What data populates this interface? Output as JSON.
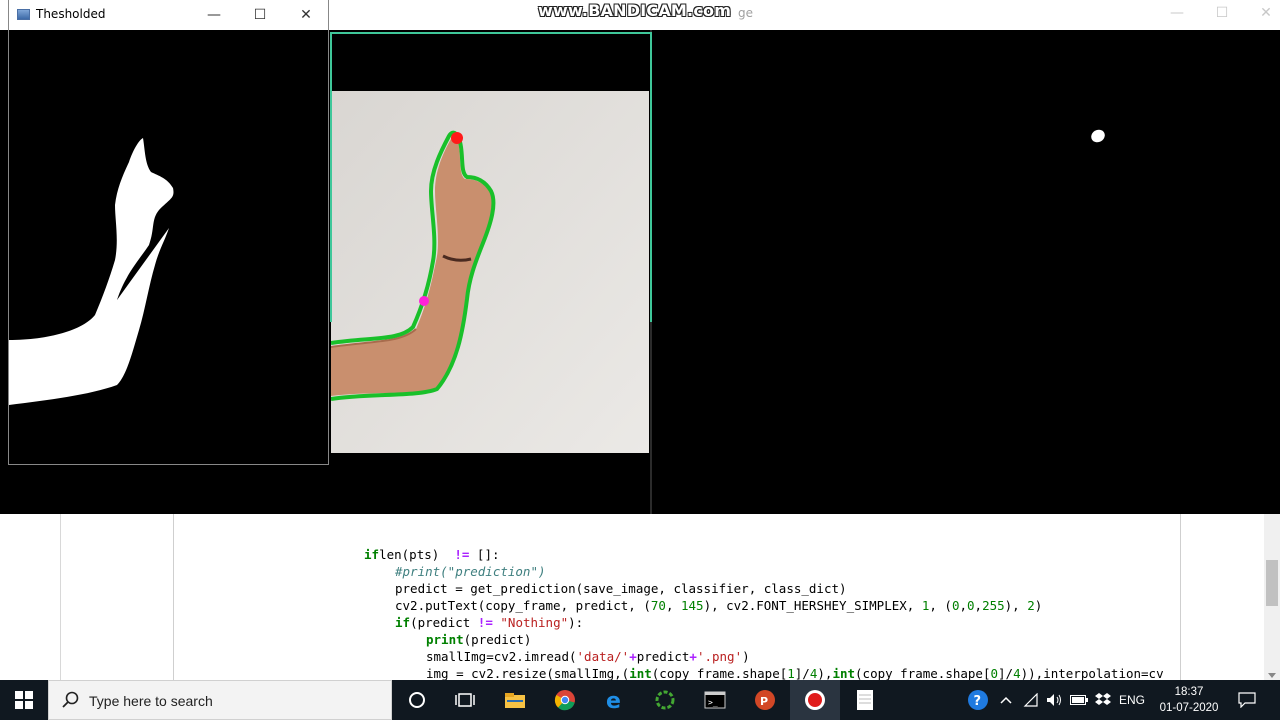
{
  "watermark": "www.BANDICAM.com",
  "camera_window": {
    "title_fragment": "ge"
  },
  "threshold_window": {
    "title": "Thesholded",
    "minimize": "—",
    "maximize": "☐",
    "close": "✕"
  },
  "code_lines": [
    {
      "indent": 0,
      "parts": [
        [
          "kw",
          "if"
        ],
        [
          "",
          "len(pts)  "
        ],
        [
          "op",
          "!="
        ],
        [
          "",
          " []:"
        ]
      ]
    },
    {
      "indent": 1,
      "parts": [
        [
          "cm",
          "#print(\"prediction\")"
        ]
      ]
    },
    {
      "indent": 1,
      "parts": [
        [
          "",
          "predict = get_prediction(save_image, classifier, class_dict)"
        ]
      ]
    },
    {
      "indent": 1,
      "parts": [
        [
          "",
          "cv2.putText(copy_frame, predict, ("
        ],
        [
          "nu",
          "70"
        ],
        [
          "",
          ", "
        ],
        [
          "nu",
          "145"
        ],
        [
          "",
          "), cv2.FONT_HERSHEY_SIMPLEX, "
        ],
        [
          "nu",
          "1"
        ],
        [
          "",
          ", ("
        ],
        [
          "nu",
          "0"
        ],
        [
          "",
          ","
        ],
        [
          "nu",
          "0"
        ],
        [
          "",
          ","
        ],
        [
          "nu",
          "255"
        ],
        [
          "",
          "), "
        ],
        [
          "nu",
          "2"
        ],
        [
          "",
          ")"
        ]
      ]
    },
    {
      "indent": 1,
      "parts": [
        [
          "kw",
          "if"
        ],
        [
          "",
          "(predict "
        ],
        [
          "op",
          "!="
        ],
        [
          "",
          " "
        ],
        [
          "st",
          "\"Nothing\""
        ],
        [
          "",
          "):"
        ]
      ]
    },
    {
      "indent": 2,
      "parts": [
        [
          "kw",
          "print"
        ],
        [
          "",
          "(predict)"
        ]
      ]
    },
    {
      "indent": 2,
      "parts": [
        [
          "",
          "smallImg=cv2.imread("
        ],
        [
          "st",
          "'data/'"
        ],
        [
          "op",
          "+"
        ],
        [
          "",
          "predict"
        ],
        [
          "op",
          "+"
        ],
        [
          "st",
          "'.png'"
        ],
        [
          "",
          ")"
        ]
      ]
    },
    {
      "indent": 2,
      "parts": [
        [
          "",
          "img = cv2.resize(smallImg,("
        ],
        [
          "kw",
          "int"
        ],
        [
          "",
          "(copy_frame.shape["
        ],
        [
          "nu",
          "1"
        ],
        [
          "",
          "]/"
        ],
        [
          "nu",
          "4"
        ],
        [
          "",
          "),"
        ],
        [
          "kw",
          "int"
        ],
        [
          "",
          "(copy_frame.shape["
        ],
        [
          "nu",
          "0"
        ],
        [
          "",
          "]/"
        ],
        [
          "nu",
          "4"
        ],
        [
          "",
          "))"
        ],
        [
          "",
          ",interpolation=cv"
        ]
      ]
    }
  ],
  "taskbar": {
    "search_placeholder": "Type here to search",
    "language": "ENG",
    "time": "18:37",
    "date": "01-07-2020"
  },
  "colors": {
    "contour": "#19c02a",
    "fingertip": "#ff1a1a",
    "wrist_point": "#ff22d8",
    "roi_box": "#3fc79a"
  }
}
